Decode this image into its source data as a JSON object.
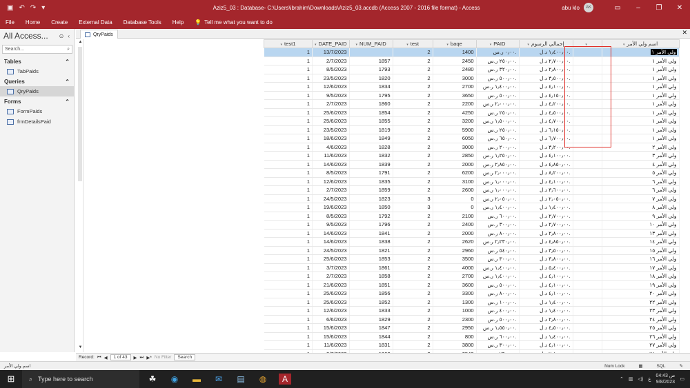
{
  "app": {
    "title": "Aziz5_03 : Database- C:\\Users\\ibrahim\\Downloads\\Aziz5_03.accdb (Access 2007 - 2016 file format)  -  Access",
    "user_name": "abu klo",
    "user_initials": "AK",
    "accent_color": "#a4262c"
  },
  "ribbon": {
    "tabs": [
      "File",
      "Home",
      "Create",
      "External Data",
      "Database Tools",
      "Help"
    ],
    "tell_me": "Tell me what you want to do"
  },
  "nav_pane": {
    "title": "All Access...",
    "search_placeholder": "Search...",
    "groups": [
      {
        "label": "Tables",
        "items": [
          "TabPaids"
        ]
      },
      {
        "label": "Queries",
        "items": [
          "QryPaids"
        ]
      },
      {
        "label": "Forms",
        "items": [
          "FormPaids",
          "frmDetailsPaid"
        ]
      }
    ]
  },
  "document_tab": {
    "label": "QryPaids"
  },
  "datasheet": {
    "columns": [
      "test1",
      "DATE_PAID",
      "NUM_PAID",
      "test",
      "baqe",
      "PAID",
      "إجمالي الرسوم",
      "",
      "اسم ولي الأمر"
    ],
    "rows": [
      [
        "1",
        "13/7/2023",
        "",
        "2",
        "1400",
        "٠٫٠٠ ر.س.",
        "١٫٤٠٠٫٠٠ د.ل.",
        "ولي الأمر ١"
      ],
      [
        "1",
        "2/7/2023",
        "1857",
        "2",
        "2450",
        "٢٥٠٫٠٠ ر.س.",
        "٢٫٧٠٠٫٠٠ د.ل.",
        "ولي الأمر ١"
      ],
      [
        "1",
        "8/5/2023",
        "1793",
        "2",
        "2480",
        "٣٢٠٫٠٠ ر.س.",
        "٢٫٨٠٠٫٠٠ د.ل.",
        "ولي الأمر ١"
      ],
      [
        "1",
        "23/5/2023",
        "1820",
        "2",
        "3000",
        "٥٠٠٫٠٠ ر.س.",
        "٣٫٥٠٠٫٠٠ د.ل.",
        "ولي الأمر ١"
      ],
      [
        "1",
        "12/6/2023",
        "1834",
        "2",
        "2700",
        "١٫٤٠٠٫٠٠ ر.س.",
        "٤٫١٠٠٫٠٠ د.ل.",
        "ولي الأمر ١"
      ],
      [
        "1",
        "9/5/2023",
        "1795",
        "2",
        "3650",
        "٥٠٠٫٠٠ ر.س.",
        "٤٫١٥٠٫٠٠ د.ل.",
        "ولي الأمر ١"
      ],
      [
        "1",
        "2/7/2023",
        "1860",
        "2",
        "2200",
        "٢٫٠٠٠٫٠٠ ر.س.",
        "٤٫٢٠٠٫٠٠ د.ل.",
        "ولي الأمر ١"
      ],
      [
        "1",
        "25/6/2023",
        "1854",
        "2",
        "4250",
        "٢٥٠٫٠٠ ر.س.",
        "٤٫٥٠٠٫٠٠ د.ل.",
        "ولي الأمر ١"
      ],
      [
        "1",
        "25/6/2023",
        "1855",
        "2",
        "3200",
        "١٫٥٠٠٫٠٠ ر.س.",
        "٤٫٧٠٠٫٠٠ د.ل.",
        "ولي الأمر ١"
      ],
      [
        "1",
        "23/5/2023",
        "1819",
        "2",
        "5900",
        "٢٥٠٫٠٠ ر.س.",
        "٦٫١٥٠٫٠٠ د.ل.",
        "ولي الأمر ١"
      ],
      [
        "1",
        "18/6/2023",
        "1849",
        "2",
        "6050",
        "٦٥٠٫٠٠ ر.س.",
        "٦٫٧٠٠٫٠٠ د.ل.",
        "ولي الأمر ١"
      ],
      [
        "1",
        "4/6/2023",
        "1828",
        "2",
        "3000",
        "٢٠٠٫٠٠ ر.س.",
        "٣٫٢٠٠٫٠٠ د.ل.",
        "ولي الأمر ٢"
      ],
      [
        "1",
        "11/6/2023",
        "1832",
        "2",
        "2850",
        "١٫٢٥٠٫٠٠ ر.س.",
        "٤٫١٠٠٫٠٠ د.ل.",
        "ولي الأمر ٣"
      ],
      [
        "1",
        "14/6/2023",
        "1839",
        "2",
        "2000",
        "٢٫٨٥٠٫٠٠ ر.س.",
        "٤٫٨٥٠٫٠٠ د.ل.",
        "ولي الأمر ٤"
      ],
      [
        "1",
        "8/5/2023",
        "1791",
        "2",
        "6200",
        "٢٫٠٠٠٫٠٠ ر.س.",
        "٨٫٢٠٠٫٠٠ د.ل.",
        "ولي الأمر ٥"
      ],
      [
        "1",
        "12/6/2023",
        "1835",
        "2",
        "3100",
        "١٫٠٠٠٫٠٠ ر.س.",
        "٤٫١٠٠٫٠٠ د.ل.",
        "ولي الأمر ٦"
      ],
      [
        "1",
        "2/7/2023",
        "1859",
        "2",
        "2600",
        "١٫٠٠٠٫٠٠ ر.س.",
        "٣٫٦٠٠٫٠٠ د.ل.",
        "ولي الأمر ٦"
      ],
      [
        "1",
        "24/5/2023",
        "1823",
        "3",
        "0",
        "٢٫٠٥٠٫٠٠ ر.س.",
        "٢٫٠٥٠٫٠٠ د.ل.",
        "ولي الأمر ٧"
      ],
      [
        "1",
        "19/6/2023",
        "1850",
        "3",
        "0",
        "١٫٤٠٠٫٠٠ ر.س.",
        "١٫٤٠٠٫٠٠ د.ل.",
        "ولي الأمر ٨"
      ],
      [
        "1",
        "8/5/2023",
        "1792",
        "2",
        "2100",
        "٦٠٠٫٠٠ ر.س.",
        "٢٫٧٠٠٫٠٠ د.ل.",
        "ولي الأمر ٩"
      ],
      [
        "1",
        "9/5/2023",
        "1796",
        "2",
        "2400",
        "٣٠٠٫٠٠ ر.س.",
        "٢٫٧٠٠٫٠٠ د.ل.",
        "ولي الأمر ١٠"
      ],
      [
        "1",
        "14/6/2023",
        "1841",
        "2",
        "2000",
        "٨٠٠٫٠٠ ر.س.",
        "٢٫٨٠٠٫٠٠ د.ل.",
        "ولي الأمر ١٣"
      ],
      [
        "1",
        "14/6/2023",
        "1838",
        "2",
        "2620",
        "٢٫٢٣٠٫٠٠ ر.س.",
        "٤٫٨٥٠٫٠٠ د.ل.",
        "ولي الأمر ١٤"
      ],
      [
        "1",
        "24/5/2023",
        "1821",
        "2",
        "2960",
        "٥٤٠٫٠٠ ر.س.",
        "٣٫٥٠٠٫٠٠ د.ل.",
        "ولي الأمر ١٥"
      ],
      [
        "1",
        "25/6/2023",
        "1853",
        "2",
        "3500",
        "٣٠٠٫٠٠ ر.س.",
        "٣٫٨٠٠٫٠٠ د.ل.",
        "ولي الأمر ١٦"
      ],
      [
        "1",
        "3/7/2023",
        "1861",
        "2",
        "4000",
        "١٫٤٠٠٫٠٠ ر.س.",
        "٥٫٤٠٠٫٠٠ د.ل.",
        "ولي الأمر ١٧"
      ],
      [
        "1",
        "2/7/2023",
        "1858",
        "2",
        "2700",
        "١٫٤٠٠٫٠٠ ر.س.",
        "٤٫١٠٠٫٠٠ د.ل.",
        "ولي الأمر ١٨"
      ],
      [
        "1",
        "21/6/2023",
        "1851",
        "2",
        "3600",
        "٥٠٠٫٠٠ ر.س.",
        "٤٫١٠٠٫٠٠ د.ل.",
        "ولي الأمر ١٩"
      ],
      [
        "1",
        "25/6/2023",
        "1856",
        "2",
        "3300",
        "٨٠٠٫٠٠ ر.س.",
        "٤٫١٠٠٫٠٠ د.ل.",
        "ولي الأمر ٢٠"
      ],
      [
        "1",
        "25/6/2023",
        "1852",
        "2",
        "1300",
        "١٠٠٫٠٠ ر.س.",
        "١٫٤٠٠٫٠٠ د.ل.",
        "ولي الأمر ٢٢"
      ],
      [
        "1",
        "12/6/2023",
        "1833",
        "2",
        "1000",
        "٤٠٠٫٠٠ ر.س.",
        "١٫٤٠٠٫٠٠ د.ل.",
        "ولي الأمر ٢٣"
      ],
      [
        "1",
        "6/6/2023",
        "1829",
        "2",
        "2300",
        "٥٠٠٫٠٠ ر.س.",
        "٢٫٨٠٠٫٠٠ د.ل.",
        "ولي الأمر ٢٤"
      ],
      [
        "1",
        "15/6/2023",
        "1847",
        "2",
        "2950",
        "١٫٥٥٠٫٠٠ ر.س.",
        "٤٫٥٠٠٫٠٠ د.ل.",
        "ولي الأمر ٢٥"
      ],
      [
        "1",
        "15/6/2023",
        "1844",
        "2",
        "800",
        "٦٠٠٫٠٠ ر.س.",
        "١٫٤٠٠٫٠٠ د.ل.",
        "ولي الأمر ٢٦"
      ],
      [
        "1",
        "11/6/2023",
        "1831",
        "2",
        "3800",
        "٣٠٠٫٠٠ ر.س.",
        "٤٫١٠٠٫٠٠ د.ل.",
        "ولي الأمر ٢٧"
      ],
      [
        "1",
        "3/7/2023",
        "1862",
        "2",
        "2540",
        "٢٦٠٫٠٠ ر.س.",
        "٢٫٨٠٠٫٠٠ د.ل.",
        "ولي الأمر ٢٨"
      ]
    ]
  },
  "record_nav": {
    "label": "Record:",
    "position": "1 of 43",
    "filter": "No Filter",
    "search": "Search"
  },
  "status_bar": {
    "left": "اسم ولي الأمر",
    "num_lock": "Num Lock"
  },
  "taskbar": {
    "search_placeholder": "Type here to search",
    "time": "04:43 ص",
    "date": "9/8/2023",
    "lang": "ع"
  }
}
